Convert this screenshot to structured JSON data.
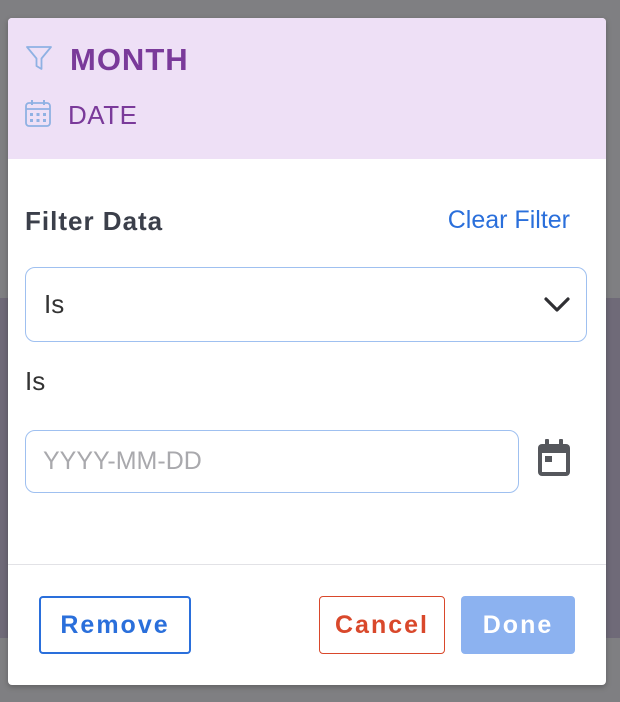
{
  "header": {
    "title": "MONTH",
    "subtitle": "DATE",
    "filter_icon": "filter-icon",
    "date_icon": "calendar-icon"
  },
  "filter": {
    "heading": "Filter Data",
    "clear_label": "Clear Filter",
    "operator_selected": "Is",
    "operator_label": "Is",
    "date_placeholder": "YYYY-MM-DD",
    "date_value": "",
    "calendar_icon": "calendar-icon"
  },
  "footer": {
    "remove_label": "Remove",
    "cancel_label": "Cancel",
    "done_label": "Done"
  },
  "colors": {
    "header_bg": "#eee0f6",
    "title": "#7a3a9a",
    "link": "#2a6fdb",
    "cancel": "#d9482b",
    "done_bg": "#8cb2f0"
  }
}
